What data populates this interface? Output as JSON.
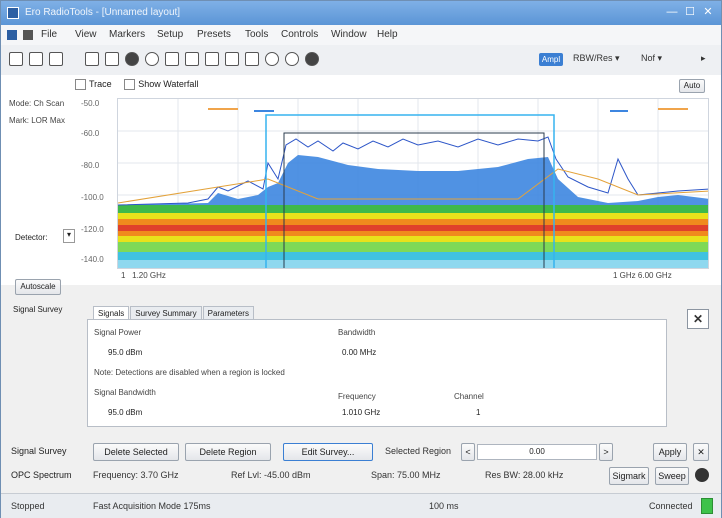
{
  "window": {
    "title": "Ero RadioTools - [Unnamed layout]"
  },
  "menu": [
    "File",
    "View",
    "Markers",
    "Setup",
    "Presets",
    "Tools",
    "Controls",
    "Window",
    "Help"
  ],
  "toolbar": {
    "right_badge": "Ampl",
    "sel1": "RBW/Res",
    "sel2": "Nof"
  },
  "spectrum": {
    "controls": {
      "opt1": "Trace",
      "opt2": "Show",
      "opt3": "Waterfall",
      "right_button": "Auto"
    },
    "left_labels": [
      "Mode: Ch Scan",
      "Mark: LOR Max"
    ],
    "detector_label": "Detector:",
    "y_ticks": [
      "-50.0",
      "-60.0",
      "-80.0",
      "-100.0",
      "-120.0",
      "-140.0"
    ],
    "foot_left1": "1",
    "foot_left2": "1.20 GHz",
    "foot_right": "1 GHz  6.00 GHz",
    "autoscale_button": "Autoscale",
    "signal_survey": "Signal Survey"
  },
  "tabs": [
    "Signals",
    "Survey Summary",
    "Parameters"
  ],
  "panel": {
    "col1_header": "Signal Power",
    "col2_header": "Bandwidth",
    "row1_c1": "95.0 dBm",
    "row1_c2": "0.00 MHz",
    "note": "Note: Detections are disabled when a region is locked",
    "h3": "Signal Bandwidth",
    "h4": "Frequency",
    "h5": "Channel",
    "row2_c1": "95.0 dBm",
    "row2_c2": "1.010 GHz",
    "row2_c3": "1"
  },
  "survey": {
    "label": "Signal Survey",
    "btn_delete": "Delete Selected",
    "btn_region": "Delete Region",
    "btn_edit": "Edit Survey...",
    "region_label": "Selected Region",
    "region_value": "0.00",
    "btn_apply": "Apply"
  },
  "spectrum_info": {
    "label": "OPC Spectrum",
    "freq": "Frequency: 3.70 GHz",
    "ref": "Ref Lvl: -45.00 dBm",
    "span": "Span: 75.00 MHz",
    "rbw": "Res BW: 28.00 kHz",
    "btn1": "Sigmark",
    "btn2": "Sweep"
  },
  "status": {
    "left": "Stopped",
    "mid": "Fast Acquisition Mode 175ms",
    "mid2": "100 ms",
    "right": "Connected"
  },
  "colors": {
    "accent": "#3b7fd3",
    "waterfall": [
      "#3fb94a",
      "#e8e21b",
      "#f08a1d",
      "#e0402b",
      "#f08a1d",
      "#e8e21b",
      "#40c2e0",
      "#2d7be0"
    ]
  }
}
